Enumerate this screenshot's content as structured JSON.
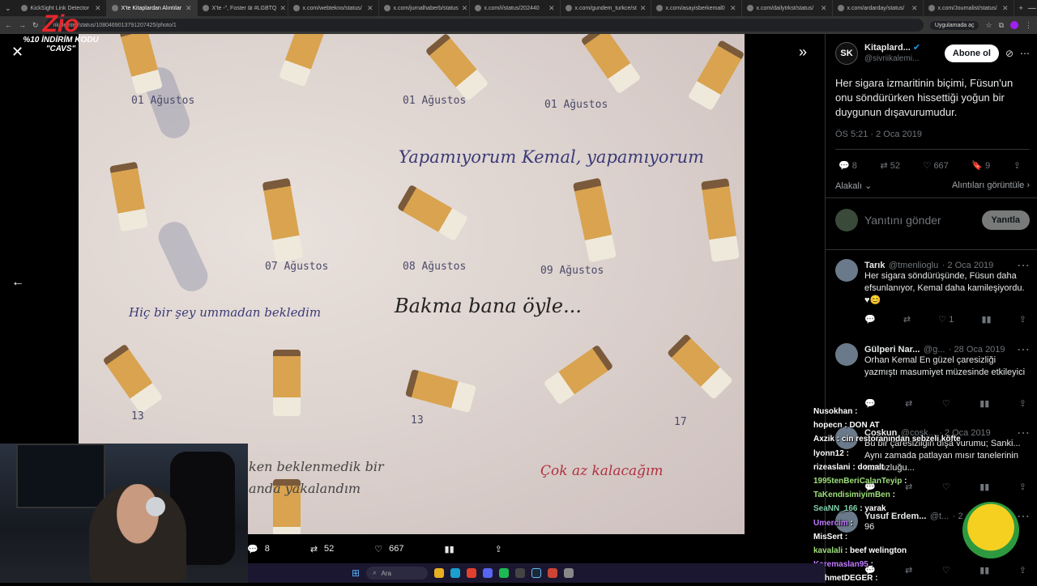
{
  "browser": {
    "tabs": [
      {
        "label": "KickSight Link Detector",
        "active": false
      },
      {
        "label": "X'te Kitaplardan Alıntılar",
        "active": true
      },
      {
        "label": "X'te -\", Foster ₪ #LGBTQ",
        "active": false
      },
      {
        "label": "x.com/webtekno/status/",
        "active": false
      },
      {
        "label": "x.com/jurnalhaberb/status",
        "active": false
      },
      {
        "label": "x.com/i/status/202440",
        "active": false
      },
      {
        "label": "x.com/gundem_turkce/st",
        "active": false
      },
      {
        "label": "x.com/asayisberkemal0",
        "active": false
      },
      {
        "label": "x.com/dailytrkst/status/",
        "active": false
      },
      {
        "label": "x.com/ardarday/status/",
        "active": false
      },
      {
        "label": "x.com/Journalist/status/",
        "active": false
      }
    ],
    "url": "rikalemler/status/1080469013791207425/photo/1",
    "open_app_label": "Uygulamada aç"
  },
  "overlay_logo": {
    "brand": "Zio",
    "promo_line1": "%10 İNDİRİM KODU",
    "promo_line2": "\"CAVS\""
  },
  "photo_notes": {
    "line1": "Yapamıyorum Kemal, yapamıyorum",
    "line2": "Hiç bir şey ummadan bekledim",
    "line3": "Bakma bana öyle...",
    "line4": "ken beklenmedik bir",
    "line5": "anda yakalandım",
    "line6": "Çok az kalacağım",
    "dates": [
      "01 Ağustos",
      "01 Ağustos",
      "01 Ağustos",
      "07 Ağustos",
      "08 Ağustos",
      "09 Ağustos",
      "13",
      "13",
      "17"
    ]
  },
  "media_actions": {
    "replies": "8",
    "reposts": "52",
    "likes": "667"
  },
  "tweet": {
    "author_name": "Kitaplard...",
    "author_handle": "@sivriikalemi...",
    "avatar_text": "SK",
    "follow_label": "Abone ol",
    "text": "Her sigara izmaritinin biçimi, Füsun'un onu söndürürken hissettiği yoğun bir duygunun dışavurumudur.",
    "timestamp": "ÖS 5:21 · 2 Oca 2019",
    "replies": "8",
    "reposts": "52",
    "likes": "667",
    "bookmarks": "9",
    "relevant_label": "Alakalı",
    "quotes_label": "Alıntıları görüntüle"
  },
  "composer": {
    "placeholder": "Yanıtını gönder",
    "reply_button": "Yanıtla"
  },
  "replies": [
    {
      "name": "Tarık",
      "handle": "@tmenlioglu",
      "date": "· 2 Oca 2019",
      "text": "Her sigara söndürüşünde, Füsun daha efsunlanıyor, Kemal daha kamileşiyordu. ♥😊",
      "likes": "1"
    },
    {
      "name": "Gülperi Nar...",
      "handle": "@g...",
      "date": "· 28 Oca 2019",
      "text": "Orhan Kemal En güzel çaresizliği yazmıştı masumiyet müzesinde etkileyici",
      "likes": ""
    },
    {
      "name": "Coskun",
      "handle": "@cosk...",
      "date": "· 2 Oca 2019",
      "text": "Bu bir çaresizliğin dışa vurumu; Sanki... Aynı zamada patlayan mısır tanelerinin tuzsuzluğu...",
      "likes": ""
    },
    {
      "name": "Yusuf Erdem...",
      "handle": "@t...",
      "date": "· 2 ...",
      "text": "96",
      "likes": ""
    }
  ],
  "chat": [
    {
      "user": "Nusokhan",
      "msg": "",
      "color": "#ffffff"
    },
    {
      "user": "hopecn",
      "msg": "DON AT",
      "color": "#ffffff"
    },
    {
      "user": "Axzik",
      "msg": "cin restoranından sebzeli köfte",
      "color": "#ffffff"
    },
    {
      "user": "lyonn12",
      "msg": "",
      "color": "#ffffff"
    },
    {
      "user": "rizeaslani",
      "msg": "domalt",
      "color": "#ffffff"
    },
    {
      "user": "1995tenBeriCalanTeyip",
      "msg": "",
      "color": "#9fe07a"
    },
    {
      "user": "TaKendisimiyimBen",
      "msg": "",
      "color": "#9fe07a"
    },
    {
      "user": "SeaNN_166",
      "msg": "yarak",
      "color": "#7fd0a8"
    },
    {
      "user": "Umercim",
      "msg": "",
      "color": "#c07aff"
    },
    {
      "user": "MisSert",
      "msg": "",
      "color": "#ffffff"
    },
    {
      "user": "kavalali",
      "msg": "beef welington",
      "color": "#9fe07a"
    },
    {
      "user": "Keremaslan95",
      "msg": "",
      "color": "#c07aff"
    },
    {
      "user": "MehmetDEGER",
      "msg": "",
      "color": "#ffffff"
    }
  ],
  "taskbar": {
    "search_label": "Ara"
  },
  "colors": {
    "accent": "#1d9bf0",
    "background": "#000000",
    "muted": "#71767b"
  }
}
